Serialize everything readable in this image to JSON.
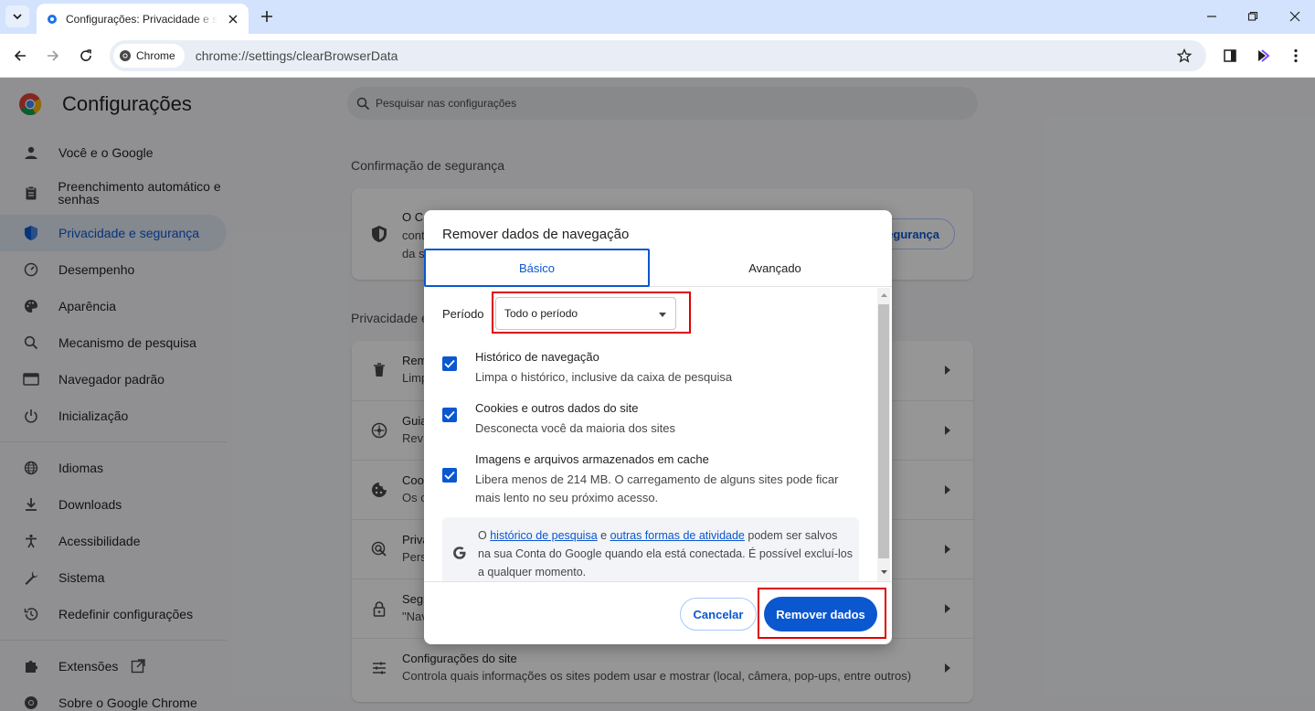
{
  "browser": {
    "tab_title": "Configurações: Privacidade e segurança",
    "chip_label": "Chrome",
    "url": "chrome://settings/clearBrowserData"
  },
  "settings": {
    "title": "Configurações",
    "search_placeholder": "Pesquisar nas configurações",
    "nav": [
      {
        "label": "Você e o Google",
        "icon": "person-icon"
      },
      {
        "label": "Preenchimento automático e senhas",
        "icon": "clipboard-icon"
      },
      {
        "label": "Privacidade e segurança",
        "icon": "shield-icon",
        "active": true
      },
      {
        "label": "Desempenho",
        "icon": "speedometer-icon"
      },
      {
        "label": "Aparência",
        "icon": "palette-icon"
      },
      {
        "label": "Mecanismo de pesquisa",
        "icon": "search-icon"
      },
      {
        "label": "Navegador padrão",
        "icon": "browser-icon"
      },
      {
        "label": "Inicialização",
        "icon": "power-icon"
      },
      {
        "label": "Idiomas",
        "icon": "globe-icon"
      },
      {
        "label": "Downloads",
        "icon": "download-icon"
      },
      {
        "label": "Acessibilidade",
        "icon": "accessibility-icon"
      },
      {
        "label": "Sistema",
        "icon": "wrench-icon"
      },
      {
        "label": "Redefinir configurações",
        "icon": "history-icon"
      },
      {
        "label": "Extensões",
        "icon": "puzzle-icon"
      },
      {
        "label": "Sobre o Google Chrome",
        "icon": "chrome-icon"
      }
    ],
    "safety_section": "Confirmação de segurança",
    "safety_card": {
      "lines": [
        "O C",
        "cont",
        "da s"
      ],
      "button_fragment": "egurança"
    },
    "privacy_section": "Privacidade e",
    "privacy_rows": [
      {
        "title": "Rem",
        "sub": "Limp",
        "icon": "trash-icon"
      },
      {
        "title": "Guia",
        "sub": "Revi",
        "icon": "compass-icon"
      },
      {
        "title": "Coo",
        "sub": "Os c",
        "icon": "cookie-icon"
      },
      {
        "title": "Priva",
        "sub": "Pers",
        "icon": "ads-icon"
      },
      {
        "title": "Segu",
        "sub": "\"Nav",
        "icon": "lock-icon"
      },
      {
        "title": "Configurações do site",
        "sub": "Controla quais informações os sites podem usar e mostrar (local, câmera, pop-ups, entre outros)",
        "icon": "tune-icon"
      }
    ]
  },
  "dialog": {
    "title": "Remover dados de navegação",
    "tabs": {
      "basic": "Básico",
      "advanced": "Avançado"
    },
    "period_label": "Período",
    "period_value": "Todo o período",
    "options": [
      {
        "title": "Histórico de navegação",
        "desc": "Limpa o histórico, inclusive da caixa de pesquisa",
        "checked": true
      },
      {
        "title": "Cookies e outros dados do site",
        "desc": "Desconecta você da maioria dos sites",
        "checked": true
      },
      {
        "title": "Imagens e arquivos armazenados em cache",
        "desc": "Libera menos de 214 MB. O carregamento de alguns sites pode ficar mais lento no seu próximo acesso.",
        "checked": true
      }
    ],
    "google_note": {
      "prefix": "O",
      "link1": "histórico de pesquisa",
      "mid": "e",
      "link2": "outras formas de atividade",
      "suffix": "podem ser salvos na sua Conta do Google quando ela está conectada. É possível excluí-los a qualquer momento."
    },
    "cancel_label": "Cancelar",
    "remove_label": "Remover dados"
  },
  "colors": {
    "accent": "#0b57d0",
    "highlight": "#e00000",
    "tabstrip": "#d3e3fd"
  }
}
